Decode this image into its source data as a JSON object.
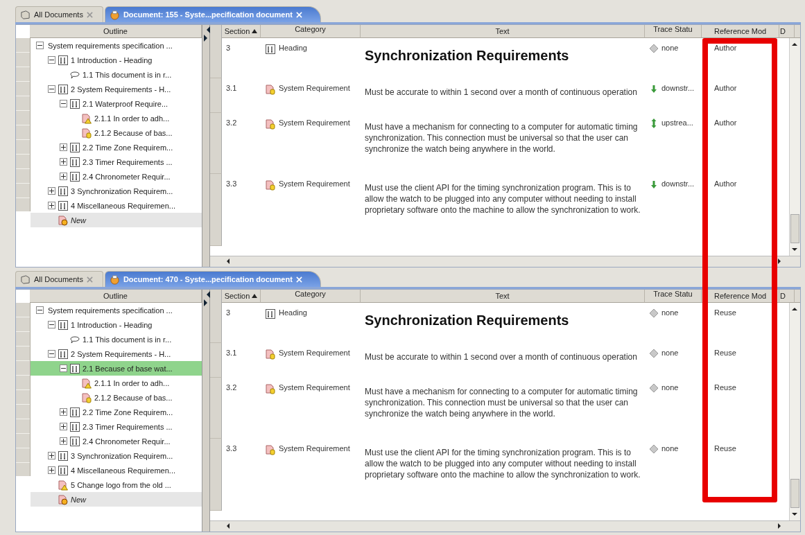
{
  "panes": [
    {
      "tabs": [
        {
          "label": "All Documents",
          "selected": false
        },
        {
          "label": "Document: 155 - Syste...pecification document",
          "selected": true
        }
      ],
      "outline": {
        "header": "Outline",
        "tree": [
          {
            "label": "System requirements specification ...",
            "kind": "document",
            "expanded": true,
            "selected": false,
            "children": [
              {
                "label": "1 Introduction - Heading",
                "kind": "heading",
                "expanded": true,
                "selected": false,
                "children": [
                  {
                    "label": "1.1 This document is in r...",
                    "kind": "comment",
                    "selected": false
                  }
                ]
              },
              {
                "label": "2 System Requirements - H...",
                "kind": "heading",
                "expanded": true,
                "selected": false,
                "children": [
                  {
                    "label": "2.1 Waterproof Require...",
                    "kind": "heading",
                    "expanded": true,
                    "selected": false,
                    "children": [
                      {
                        "label": "2.1.1 In order to adh...",
                        "kind": "warning",
                        "selected": false
                      },
                      {
                        "label": "2.1.2 Because of bas...",
                        "kind": "requirement",
                        "selected": false
                      }
                    ]
                  },
                  {
                    "label": "2.2 Time Zone Requirem...",
                    "kind": "heading",
                    "expanded": false,
                    "selected": false
                  },
                  {
                    "label": "2.3 Timer Requirements ...",
                    "kind": "heading",
                    "expanded": false,
                    "selected": false
                  },
                  {
                    "label": "2.4 Chronometer Requir...",
                    "kind": "heading",
                    "expanded": false,
                    "selected": false
                  }
                ]
              },
              {
                "label": "3 Synchronization Requirem...",
                "kind": "heading",
                "expanded": false,
                "selected": false
              },
              {
                "label": "4 Miscellaneous Requiremen...",
                "kind": "heading",
                "expanded": false,
                "selected": false
              },
              {
                "label": "New",
                "kind": "new",
                "selected": false
              }
            ]
          }
        ]
      },
      "table": {
        "columns": [
          {
            "label": "Section",
            "sorted": true
          },
          {
            "label": "Category",
            "sorted": false
          },
          {
            "label": "Text",
            "sorted": false
          },
          {
            "label": "Trace Statu",
            "sorted": false
          },
          {
            "label": "Reference Mod",
            "sorted": false
          },
          {
            "label": "D",
            "sorted": false
          }
        ],
        "rows": [
          {
            "section": "3",
            "category": {
              "kind": "heading",
              "label": "Heading"
            },
            "text": "Synchronization Requirements",
            "trace": {
              "kind": "none",
              "label": "none"
            },
            "reference_mode": "Author"
          },
          {
            "section": "3.1",
            "category": {
              "kind": "requirement",
              "label": "System Requirement"
            },
            "text": "Must be accurate to within 1 second over a month of continuous operation",
            "trace": {
              "kind": "downstream",
              "label": "downstr..."
            },
            "reference_mode": "Author"
          },
          {
            "section": "3.2",
            "category": {
              "kind": "requirement",
              "label": "System Requirement"
            },
            "text": "Must have a mechanism for connecting to a computer for automatic timing synchronization. This connection must be universal so that the user can synchronize the watch being anywhere in the world.",
            "trace": {
              "kind": "upstream",
              "label": "upstrea..."
            },
            "reference_mode": "Author"
          },
          {
            "section": "3.3",
            "category": {
              "kind": "requirement",
              "label": "System Requirement"
            },
            "text": "Must use the client API for the timing synchronization program. This is to allow the watch to be plugged into any computer without needing to install proprietary software onto the machine to allow the synchronization to work.",
            "trace": {
              "kind": "downstream",
              "label": "downstr..."
            },
            "reference_mode": "Author"
          }
        ]
      }
    },
    {
      "tabs": [
        {
          "label": "All Documents",
          "selected": false
        },
        {
          "label": "Document: 470 - Syste...pecification document",
          "selected": true
        }
      ],
      "outline": {
        "header": "Outline",
        "tree": [
          {
            "label": "System requirements specification ...",
            "kind": "document",
            "expanded": true,
            "selected": false,
            "children": [
              {
                "label": "1 Introduction - Heading",
                "kind": "heading",
                "expanded": true,
                "selected": false,
                "children": [
                  {
                    "label": "1.1 This document is in r...",
                    "kind": "comment",
                    "selected": false
                  }
                ]
              },
              {
                "label": "2 System Requirements - H...",
                "kind": "heading",
                "expanded": true,
                "selected": false,
                "children": [
                  {
                    "label": "2.1 Because of base wat...",
                    "kind": "heading",
                    "expanded": true,
                    "selected": true,
                    "children": [
                      {
                        "label": "2.1.1 In order to adh...",
                        "kind": "warning",
                        "selected": false
                      },
                      {
                        "label": "2.1.2 Because of bas...",
                        "kind": "requirement",
                        "selected": false
                      }
                    ]
                  },
                  {
                    "label": "2.2 Time Zone Requirem...",
                    "kind": "heading",
                    "expanded": false,
                    "selected": false
                  },
                  {
                    "label": "2.3 Timer Requirements ...",
                    "kind": "heading",
                    "expanded": false,
                    "selected": false
                  },
                  {
                    "label": "2.4 Chronometer Requir...",
                    "kind": "heading",
                    "expanded": false,
                    "selected": false
                  }
                ]
              },
              {
                "label": "3 Synchronization Requirem...",
                "kind": "heading",
                "expanded": false,
                "selected": false
              },
              {
                "label": "4 Miscellaneous Requiremen...",
                "kind": "heading",
                "expanded": false,
                "selected": false
              },
              {
                "label": "5 Change logo from the old ...",
                "kind": "warning",
                "selected": false
              },
              {
                "label": "New",
                "kind": "new",
                "selected": false
              }
            ]
          }
        ]
      },
      "table": {
        "columns": [
          {
            "label": "Section",
            "sorted": true
          },
          {
            "label": "Category",
            "sorted": false
          },
          {
            "label": "Text",
            "sorted": false
          },
          {
            "label": "Trace Statu",
            "sorted": false
          },
          {
            "label": "Reference Mod",
            "sorted": false
          },
          {
            "label": "D",
            "sorted": false
          }
        ],
        "rows": [
          {
            "section": "3",
            "category": {
              "kind": "heading",
              "label": "Heading"
            },
            "text": "Synchronization Requirements",
            "trace": {
              "kind": "none",
              "label": "none"
            },
            "reference_mode": "Reuse"
          },
          {
            "section": "3.1",
            "category": {
              "kind": "requirement",
              "label": "System Requirement"
            },
            "text": "Must be accurate to within 1 second over a month of continuous operation",
            "trace": {
              "kind": "none",
              "label": "none"
            },
            "reference_mode": "Reuse"
          },
          {
            "section": "3.2",
            "category": {
              "kind": "requirement",
              "label": "System Requirement"
            },
            "text": "Must have a mechanism for connecting to a computer for automatic timing synchronization. This connection must be universal so that the user can synchronize the watch being anywhere in the world.",
            "trace": {
              "kind": "none",
              "label": "none"
            },
            "reference_mode": "Reuse"
          },
          {
            "section": "3.3",
            "category": {
              "kind": "requirement",
              "label": "System Requirement"
            },
            "text": "Must use the client API for the timing synchronization program. This is to allow the watch to be plugged into any computer without needing to install proprietary software onto the machine to allow the synchronization to work.",
            "trace": {
              "kind": "none",
              "label": "none"
            },
            "reference_mode": "Reuse"
          }
        ]
      }
    }
  ]
}
